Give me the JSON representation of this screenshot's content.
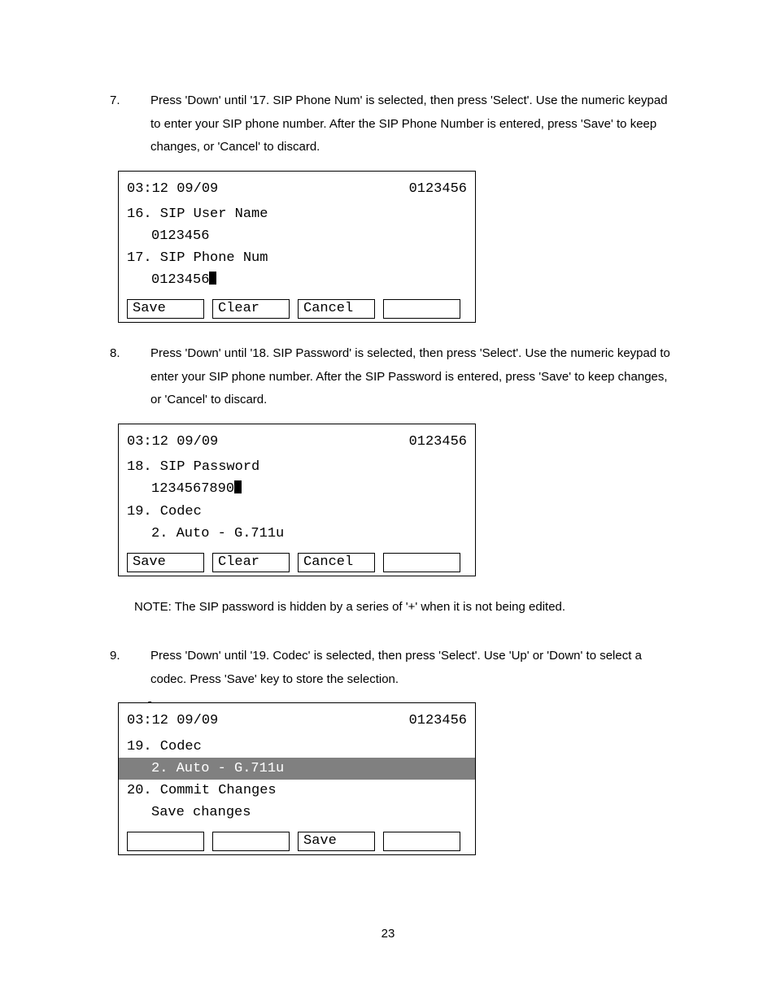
{
  "steps": {
    "s7": {
      "num": "7.",
      "text": "Press 'Down' until '17. SIP Phone Num' is selected, then press 'Select'.    Use the numeric keypad to enter your SIP phone number.    After the SIP Phone Number is entered, press 'Save' to keep changes, or 'Cancel' to discard."
    },
    "s8": {
      "num": "8.",
      "text": "Press 'Down' until '18. SIP Password' is selected, then press 'Select'.    Use the numeric keypad to enter your SIP phone number.    After the SIP Password is entered, press 'Save' to keep changes, or 'Cancel' to discard."
    },
    "s9": {
      "num": "9.",
      "text": "Press 'Down' until '19. Codec' is selected, then press 'Select'. Use 'Up' or 'Down' to select a codec.    Press 'Save' key to store the selection."
    }
  },
  "note": "NOTE: The SIP password is hidden by a series of '+' when it is not being edited.",
  "lcd1": {
    "time": "03:12 09/09",
    "ext": "0123456",
    "line1": "16. SIP User Name",
    "line1v": "0123456",
    "line2": "17. SIP Phone Num",
    "line2v": "0123456",
    "sk1": "Save",
    "sk2": "Clear",
    "sk3": "Cancel",
    "sk4": ""
  },
  "lcd2": {
    "time": "03:12 09/09",
    "ext": "0123456",
    "line1": "18. SIP Password",
    "line1v": "1234567890",
    "line2": "19. Codec",
    "line2v": "2. Auto - G.711u",
    "sk1": "Save",
    "sk2": "Clear",
    "sk3": "Cancel",
    "sk4": ""
  },
  "lcd3": {
    "time": "03:12 09/09",
    "ext": "0123456",
    "line1": "19. Codec",
    "line1v": "2. Auto - G.711u",
    "line2": "20. Commit Changes",
    "line2v": "Save changes",
    "sk1": "",
    "sk2": "",
    "sk3": "Save",
    "sk4": ""
  },
  "pageNumber": "23"
}
